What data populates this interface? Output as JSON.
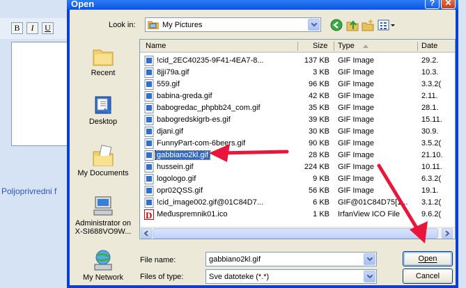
{
  "background": {
    "format_buttons": [
      "B",
      "I",
      "U"
    ],
    "link_text": "Poljoprivredni f"
  },
  "dialog": {
    "title": "Open",
    "help_label": "?",
    "close_label": "✕",
    "look_in_label": "Look in:",
    "look_in_value": "My Pictures",
    "toolbar_icons": [
      "back-icon",
      "up-folder-icon",
      "new-folder-icon",
      "views-menu-icon"
    ]
  },
  "places": [
    {
      "label": "Recent",
      "icon": "recent-folder-icon"
    },
    {
      "label": "Desktop",
      "icon": "desktop-icon"
    },
    {
      "label": "My Documents",
      "icon": "my-documents-icon"
    },
    {
      "label": "Administrator on X-SI688VO9W...",
      "line1": "Administrator on",
      "line2": "X-SI688VO9W...",
      "icon": "computer-icon"
    },
    {
      "label": "My Network",
      "icon": "network-icon"
    }
  ],
  "columns": {
    "name": "Name",
    "size": "Size",
    "type": "Type",
    "date": "Date"
  },
  "files": [
    {
      "name": "!cid_2EC40235-9F41-4EA7-8...",
      "size": "137 KB",
      "type": "GIF Image",
      "date": "29.2."
    },
    {
      "name": "8jji79a.gif",
      "size": "3 KB",
      "type": "GIF Image",
      "date": "10.3."
    },
    {
      "name": "559.gif",
      "size": "96 KB",
      "type": "GIF Image",
      "date": "3.3.2("
    },
    {
      "name": "babina-greda.gif",
      "size": "42 KB",
      "type": "GIF Image",
      "date": "2.11."
    },
    {
      "name": "babogredac_phpbb24_com.gif",
      "size": "35 KB",
      "type": "GIF Image",
      "date": "28.1."
    },
    {
      "name": "babogredskigrb-es.gif",
      "size": "39 KB",
      "type": "GIF Image",
      "date": "15.11."
    },
    {
      "name": "djani.gif",
      "size": "30 KB",
      "type": "GIF Image",
      "date": "30.9."
    },
    {
      "name": "FunnyPart-com-6beers.gif",
      "size": "90 KB",
      "type": "GIF Image",
      "date": "3.5.2("
    },
    {
      "name": "gabbiano2kl.gif",
      "size": "28 KB",
      "type": "GIF Image",
      "date": "21.10.",
      "selected": true
    },
    {
      "name": "hussein.gif",
      "size": "224 KB",
      "type": "GIF Image",
      "date": "10.11."
    },
    {
      "name": "logologo.gif",
      "size": "9 KB",
      "type": "GIF Image",
      "date": "6.3.2("
    },
    {
      "name": "opr02QSS.gif",
      "size": "56 KB",
      "type": "GIF Image",
      "date": "19.1."
    },
    {
      "name": "!cid_image002.gif@01C84D7...",
      "size": "6 KB",
      "type": "GIF@01C84D75[1...",
      "date": "3.1.2("
    },
    {
      "name": "Međuspremnik01.ico",
      "size": "1 KB",
      "type": "IrfanView ICO File",
      "date": "9.6.2("
    }
  ],
  "file_name_label": "File name:",
  "file_name_value": "gabbiano2kl.gif",
  "file_type_label": "Files of type:",
  "file_type_value": "Sve datoteke (*.*)",
  "open_label": "Open",
  "cancel_label": "Cancel",
  "colors": {
    "title_bar": "#0b54e0",
    "selection": "#316ac5",
    "annotation_arrow": "#e8163a"
  }
}
